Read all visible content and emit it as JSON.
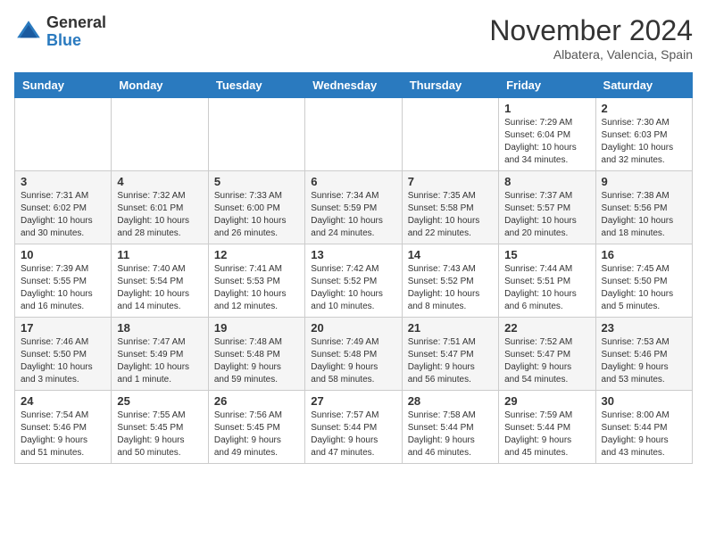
{
  "header": {
    "logo_general": "General",
    "logo_blue": "Blue",
    "month_title": "November 2024",
    "location": "Albatera, Valencia, Spain"
  },
  "weekdays": [
    "Sunday",
    "Monday",
    "Tuesday",
    "Wednesday",
    "Thursday",
    "Friday",
    "Saturday"
  ],
  "weeks": [
    [
      {
        "day": "",
        "info": ""
      },
      {
        "day": "",
        "info": ""
      },
      {
        "day": "",
        "info": ""
      },
      {
        "day": "",
        "info": ""
      },
      {
        "day": "",
        "info": ""
      },
      {
        "day": "1",
        "info": "Sunrise: 7:29 AM\nSunset: 6:04 PM\nDaylight: 10 hours\nand 34 minutes."
      },
      {
        "day": "2",
        "info": "Sunrise: 7:30 AM\nSunset: 6:03 PM\nDaylight: 10 hours\nand 32 minutes."
      }
    ],
    [
      {
        "day": "3",
        "info": "Sunrise: 7:31 AM\nSunset: 6:02 PM\nDaylight: 10 hours\nand 30 minutes."
      },
      {
        "day": "4",
        "info": "Sunrise: 7:32 AM\nSunset: 6:01 PM\nDaylight: 10 hours\nand 28 minutes."
      },
      {
        "day": "5",
        "info": "Sunrise: 7:33 AM\nSunset: 6:00 PM\nDaylight: 10 hours\nand 26 minutes."
      },
      {
        "day": "6",
        "info": "Sunrise: 7:34 AM\nSunset: 5:59 PM\nDaylight: 10 hours\nand 24 minutes."
      },
      {
        "day": "7",
        "info": "Sunrise: 7:35 AM\nSunset: 5:58 PM\nDaylight: 10 hours\nand 22 minutes."
      },
      {
        "day": "8",
        "info": "Sunrise: 7:37 AM\nSunset: 5:57 PM\nDaylight: 10 hours\nand 20 minutes."
      },
      {
        "day": "9",
        "info": "Sunrise: 7:38 AM\nSunset: 5:56 PM\nDaylight: 10 hours\nand 18 minutes."
      }
    ],
    [
      {
        "day": "10",
        "info": "Sunrise: 7:39 AM\nSunset: 5:55 PM\nDaylight: 10 hours\nand 16 minutes."
      },
      {
        "day": "11",
        "info": "Sunrise: 7:40 AM\nSunset: 5:54 PM\nDaylight: 10 hours\nand 14 minutes."
      },
      {
        "day": "12",
        "info": "Sunrise: 7:41 AM\nSunset: 5:53 PM\nDaylight: 10 hours\nand 12 minutes."
      },
      {
        "day": "13",
        "info": "Sunrise: 7:42 AM\nSunset: 5:52 PM\nDaylight: 10 hours\nand 10 minutes."
      },
      {
        "day": "14",
        "info": "Sunrise: 7:43 AM\nSunset: 5:52 PM\nDaylight: 10 hours\nand 8 minutes."
      },
      {
        "day": "15",
        "info": "Sunrise: 7:44 AM\nSunset: 5:51 PM\nDaylight: 10 hours\nand 6 minutes."
      },
      {
        "day": "16",
        "info": "Sunrise: 7:45 AM\nSunset: 5:50 PM\nDaylight: 10 hours\nand 5 minutes."
      }
    ],
    [
      {
        "day": "17",
        "info": "Sunrise: 7:46 AM\nSunset: 5:50 PM\nDaylight: 10 hours\nand 3 minutes."
      },
      {
        "day": "18",
        "info": "Sunrise: 7:47 AM\nSunset: 5:49 PM\nDaylight: 10 hours\nand 1 minute."
      },
      {
        "day": "19",
        "info": "Sunrise: 7:48 AM\nSunset: 5:48 PM\nDaylight: 9 hours\nand 59 minutes."
      },
      {
        "day": "20",
        "info": "Sunrise: 7:49 AM\nSunset: 5:48 PM\nDaylight: 9 hours\nand 58 minutes."
      },
      {
        "day": "21",
        "info": "Sunrise: 7:51 AM\nSunset: 5:47 PM\nDaylight: 9 hours\nand 56 minutes."
      },
      {
        "day": "22",
        "info": "Sunrise: 7:52 AM\nSunset: 5:47 PM\nDaylight: 9 hours\nand 54 minutes."
      },
      {
        "day": "23",
        "info": "Sunrise: 7:53 AM\nSunset: 5:46 PM\nDaylight: 9 hours\nand 53 minutes."
      }
    ],
    [
      {
        "day": "24",
        "info": "Sunrise: 7:54 AM\nSunset: 5:46 PM\nDaylight: 9 hours\nand 51 minutes."
      },
      {
        "day": "25",
        "info": "Sunrise: 7:55 AM\nSunset: 5:45 PM\nDaylight: 9 hours\nand 50 minutes."
      },
      {
        "day": "26",
        "info": "Sunrise: 7:56 AM\nSunset: 5:45 PM\nDaylight: 9 hours\nand 49 minutes."
      },
      {
        "day": "27",
        "info": "Sunrise: 7:57 AM\nSunset: 5:44 PM\nDaylight: 9 hours\nand 47 minutes."
      },
      {
        "day": "28",
        "info": "Sunrise: 7:58 AM\nSunset: 5:44 PM\nDaylight: 9 hours\nand 46 minutes."
      },
      {
        "day": "29",
        "info": "Sunrise: 7:59 AM\nSunset: 5:44 PM\nDaylight: 9 hours\nand 45 minutes."
      },
      {
        "day": "30",
        "info": "Sunrise: 8:00 AM\nSunset: 5:44 PM\nDaylight: 9 hours\nand 43 minutes."
      }
    ]
  ]
}
